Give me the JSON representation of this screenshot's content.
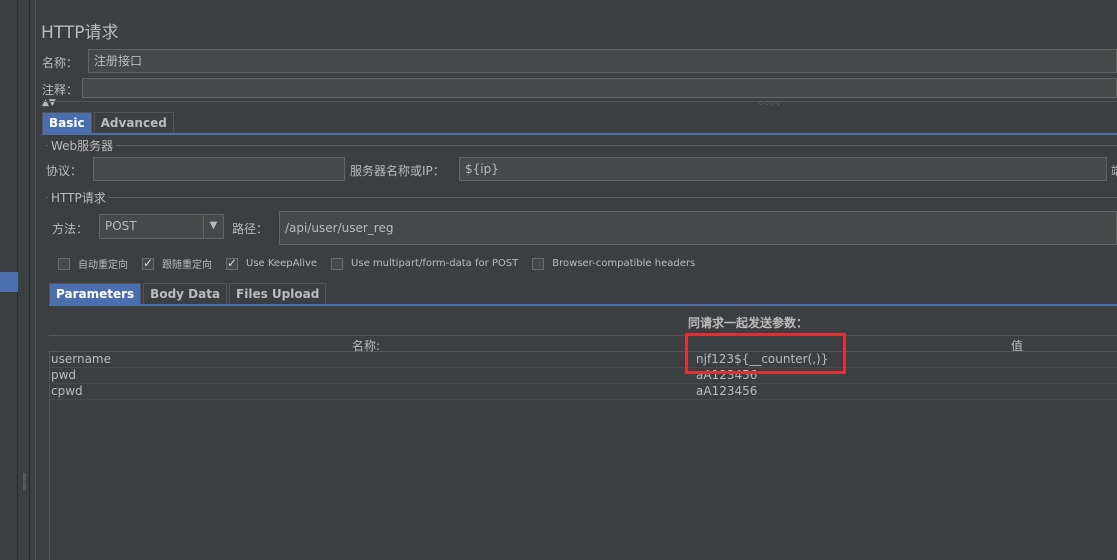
{
  "panel_title": "HTTP请求",
  "name_label": "名称：",
  "name_value": "注册接口",
  "comment_label": "注释：",
  "comment_value": "",
  "tabs_top": [
    "Basic",
    "Advanced"
  ],
  "web_server": {
    "section_title": "Web服务器",
    "protocol_label": "协议：",
    "protocol_value": "",
    "server_label": "服务器名称或IP：",
    "server_value": "${ip}",
    "port_label_partial": "端"
  },
  "http_request": {
    "section_title": "HTTP请求",
    "method_label": "方法：",
    "method_value": "POST",
    "path_label": "路径：",
    "path_value": "/api/user/user_reg"
  },
  "checkboxes": [
    {
      "label": "自动重定向",
      "checked": false
    },
    {
      "label": "跟随重定向",
      "checked": true
    },
    {
      "label": "Use KeepAlive",
      "checked": true
    },
    {
      "label": "Use multipart/form-data for POST",
      "checked": false
    },
    {
      "label": "Browser-compatible headers",
      "checked": false
    }
  ],
  "tabs_params": [
    "Parameters",
    "Body Data",
    "Files Upload"
  ],
  "params": {
    "caption": "同请求一起发送参数：",
    "col_name": "名称:",
    "col_value": "值",
    "rows": [
      {
        "name": "username",
        "value": "njf123${__counter(,)}"
      },
      {
        "name": "pwd",
        "value": "aA123456"
      },
      {
        "name": "cpwd",
        "value": "aA123456"
      }
    ]
  },
  "colors": {
    "accent": "#4b6eaf",
    "highlight": "#e03030",
    "background": "#3c3f41"
  }
}
